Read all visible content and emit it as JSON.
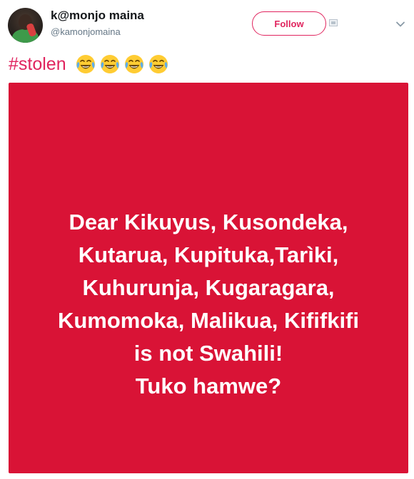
{
  "tweet": {
    "author": {
      "display_name": "k@monjo maina",
      "handle": "@kamonjomaina"
    },
    "follow_label": "Follow",
    "text": {
      "hashtag": "#stolen",
      "emojis": [
        "face-with-tears-of-joy",
        "face-with-tears-of-joy",
        "face-with-tears-of-joy",
        "face-with-tears-of-joy"
      ]
    },
    "media": {
      "background_color": "#d91336",
      "lines": [
        "Dear Kikuyus, Kusondeka,",
        "Kutarua, Kupituka,Tarìki,",
        "Kuhurunja, Kugaragara,",
        "Kumomoka, Malikua, Kififkifi",
        "is not Swahili!",
        "Tuko hamwe?"
      ]
    }
  },
  "colors": {
    "accent": "#e0245e",
    "name": "#14171a",
    "secondary": "#657786"
  }
}
